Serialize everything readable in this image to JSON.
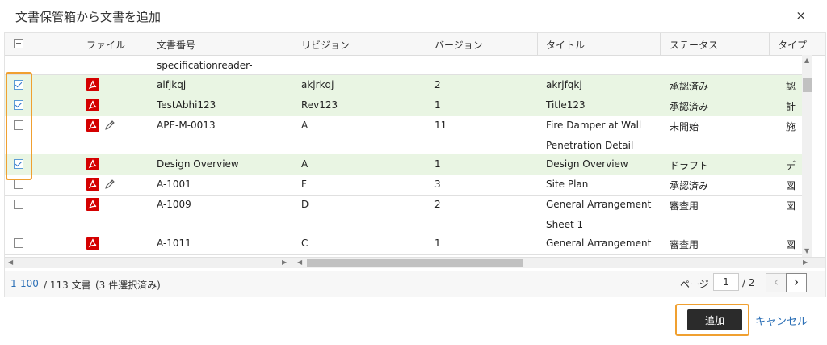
{
  "dialog": {
    "title": "文書保管箱から文書を追加",
    "close_icon": "×"
  },
  "columns": [
    "ファイル",
    "文書番号",
    "リビジョン",
    "バージョン",
    "タイトル",
    "ステータス",
    "タイプ"
  ],
  "first_row_partial": "specificationreader-",
  "rows": [
    {
      "checked": true,
      "edit": false,
      "doc": "alfjkqj",
      "rev": "akjrkqj",
      "ver": "2",
      "title": "akrjfqkj",
      "title2": "",
      "status": "承認済み",
      "type": "認"
    },
    {
      "checked": true,
      "edit": false,
      "doc": "TestAbhi123",
      "rev": "Rev123",
      "ver": "1",
      "title": "Title123",
      "title2": "",
      "status": "承認済み",
      "type": "計"
    },
    {
      "checked": false,
      "edit": true,
      "doc": "APE-M-0013",
      "rev": "A",
      "ver": "11",
      "title": "Fire Damper at Wall",
      "title2": "Penetration Detail",
      "status": "未開始",
      "type": "施"
    },
    {
      "checked": true,
      "edit": false,
      "doc": "Design Overview",
      "rev": "A",
      "ver": "1",
      "title": "Design Overview",
      "title2": "",
      "status": "ドラフト",
      "type": "デ"
    },
    {
      "checked": false,
      "edit": true,
      "doc": "A-1001",
      "rev": "F",
      "ver": "3",
      "title": "Site Plan",
      "title2": "",
      "status": "承認済み",
      "type": "図"
    },
    {
      "checked": false,
      "edit": false,
      "doc": "A-1009",
      "rev": "D",
      "ver": "2",
      "title": "General Arrangement",
      "title2": "Sheet 1",
      "status": "審査用",
      "type": "図"
    },
    {
      "checked": false,
      "edit": false,
      "doc": "A-1011",
      "rev": "C",
      "ver": "1",
      "title": "General Arrangement",
      "title2": "",
      "status": "審査用",
      "type": "図"
    }
  ],
  "footer": {
    "range": "1-100",
    "total": "/ 113 文書",
    "selected": "(3 件選択済み)",
    "page_label": "ページ",
    "page_value": "1",
    "page_total": "/ 2",
    "prev_icon": "‹",
    "next_icon": "›"
  },
  "actions": {
    "add_label": "追加",
    "cancel_label": "キャンセル"
  },
  "colors": {
    "selected_row": "#e9f5e3",
    "pdf_red": "#d40000",
    "highlight": "#f0a030",
    "link": "#2b6fb6"
  }
}
